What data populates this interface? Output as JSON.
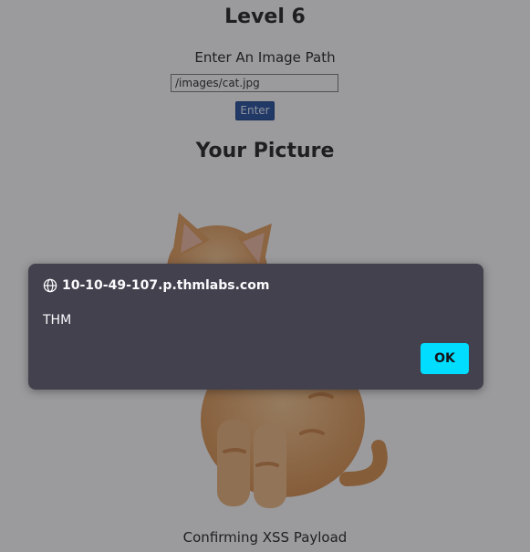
{
  "page": {
    "title": "Level 6",
    "input_label": "Enter An Image Path",
    "path_value": "/images/cat.jpg",
    "enter_label": "Enter",
    "picture_heading": "Your Picture",
    "caption": "Confirming XSS Payload"
  },
  "alert": {
    "origin": "10-10-49-107.p.thmlabs.com",
    "message": "THM",
    "ok_label": "OK"
  },
  "icons": {
    "origin_icon": "globe-icon"
  },
  "colors": {
    "dialog_bg": "#42414d",
    "ok_button": "#00ddff",
    "enter_button": "#1f4a9a"
  }
}
